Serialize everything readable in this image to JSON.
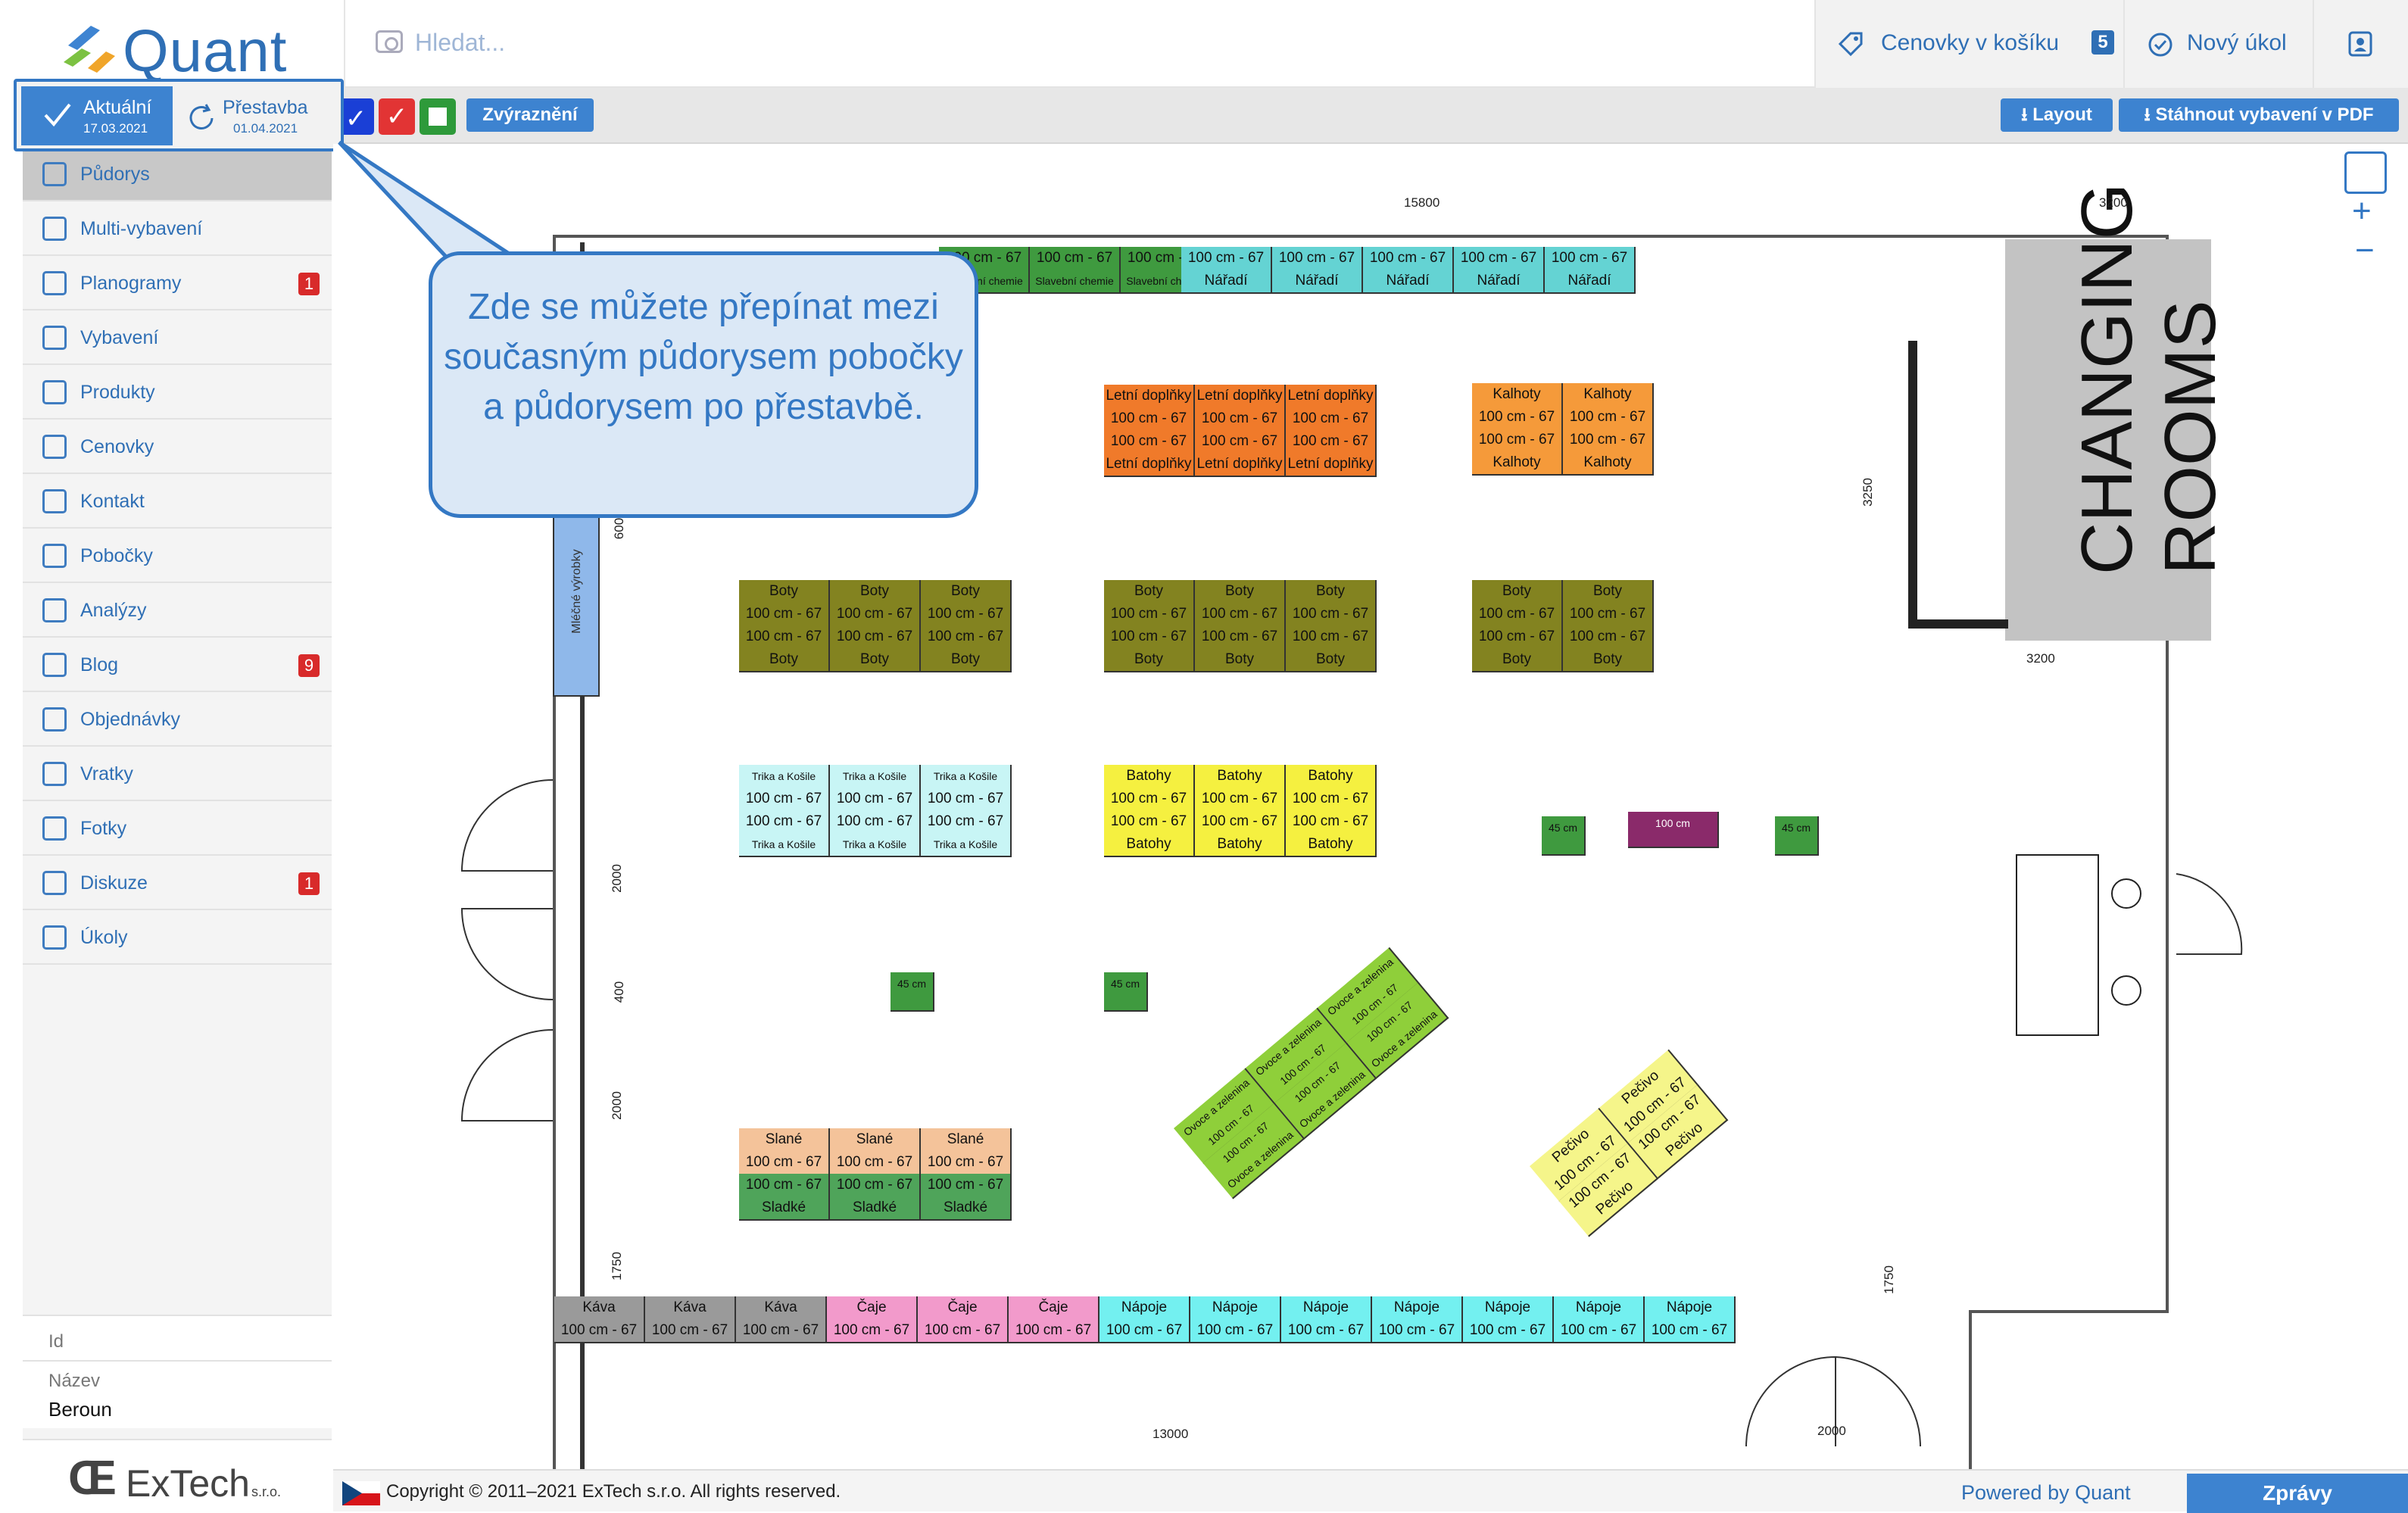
{
  "app": {
    "name": "Quant"
  },
  "search": {
    "placeholder": "Hledat..."
  },
  "header": {
    "cart_label": "Cenovky v košíku",
    "cart_count": "5",
    "new_task_label": "Nový úkol"
  },
  "versions": {
    "current": {
      "label": "Aktuální",
      "date": "17.03.2021"
    },
    "rebuild": {
      "label": "Přestavba",
      "date": "01.04.2021"
    }
  },
  "toolbar": {
    "highlight_label": "Zvýraznění",
    "layout_label": "Layout",
    "download_label": "Stáhnout vybavení v PDF",
    "filter_colors": [
      "#1a3fd6",
      "#e23434",
      "#2e9a3a"
    ]
  },
  "sidebar": {
    "items": [
      {
        "label": "Půdorys",
        "icon": "floorplan-icon",
        "count": ""
      },
      {
        "label": "Multi-vybavení",
        "icon": "multi-equipment-icon",
        "count": ""
      },
      {
        "label": "Planogramy",
        "icon": "planogram-icon",
        "count": "1"
      },
      {
        "label": "Vybavení",
        "icon": "equipment-icon",
        "count": ""
      },
      {
        "label": "Produkty",
        "icon": "products-icon",
        "count": ""
      },
      {
        "label": "Cenovky",
        "icon": "price-tag-icon",
        "count": ""
      },
      {
        "label": "Kontakt",
        "icon": "contact-icon",
        "count": ""
      },
      {
        "label": "Pobočky",
        "icon": "branches-icon",
        "count": ""
      },
      {
        "label": "Analýzy",
        "icon": "analytics-icon",
        "count": ""
      },
      {
        "label": "Blog",
        "icon": "blog-icon",
        "count": "9"
      },
      {
        "label": "Objednávky",
        "icon": "orders-icon",
        "count": ""
      },
      {
        "label": "Vratky",
        "icon": "returns-icon",
        "count": ""
      },
      {
        "label": "Fotky",
        "icon": "photos-icon",
        "count": ""
      },
      {
        "label": "Diskuze",
        "icon": "discussion-icon",
        "count": "1"
      },
      {
        "label": "Úkoly",
        "icon": "tasks-icon",
        "count": ""
      }
    ],
    "info": {
      "id_label": "Id",
      "name_label": "Název",
      "name_value": "Beroun"
    },
    "brand": {
      "name": "ExTech",
      "suffix": "s.r.o."
    }
  },
  "callout": {
    "text": "Zde se můžete přepínat mezi současným půdorysem pobočky a půdorysem po přestavbě."
  },
  "floorplan": {
    "changing_rooms_line1": "CHANGING",
    "changing_rooms_line2": "ROOMS",
    "dims": {
      "d15800": "15800",
      "d3200a": "3200",
      "d3250": "3250",
      "d3200b": "3200",
      "d600": "600",
      "d2000a": "2000",
      "d400": "400",
      "d2000b": "2000",
      "d1750a": "1750",
      "d1750b": "1750",
      "d13000": "13000",
      "d2000c": "2000"
    },
    "seg": "100 cm - 67",
    "labels": {
      "naradi": "Nářadí",
      "letni": "Letní doplňky",
      "kalhoty": "Kalhoty",
      "boty": "Boty",
      "trika": "Trika a Košile",
      "batohy": "Batohy",
      "slane": "Slané",
      "sladke": "Sladké",
      "kava": "Káva",
      "caje": "Čaje",
      "napoje": "Nápoje",
      "mlecne": "Mléčné výrobky",
      "ovoce": "Ovoce a zelenina",
      "pecivo": "Pečivo",
      "chemie": "Slavební chemie",
      "cm45": "45 cm",
      "cm100": "100 cm"
    }
  },
  "footer": {
    "copyright": "Copyright © 2011–2021 ExTech s.r.o. All rights reserved.",
    "powered": "Powered by Quant",
    "messages": "Zprávy"
  }
}
